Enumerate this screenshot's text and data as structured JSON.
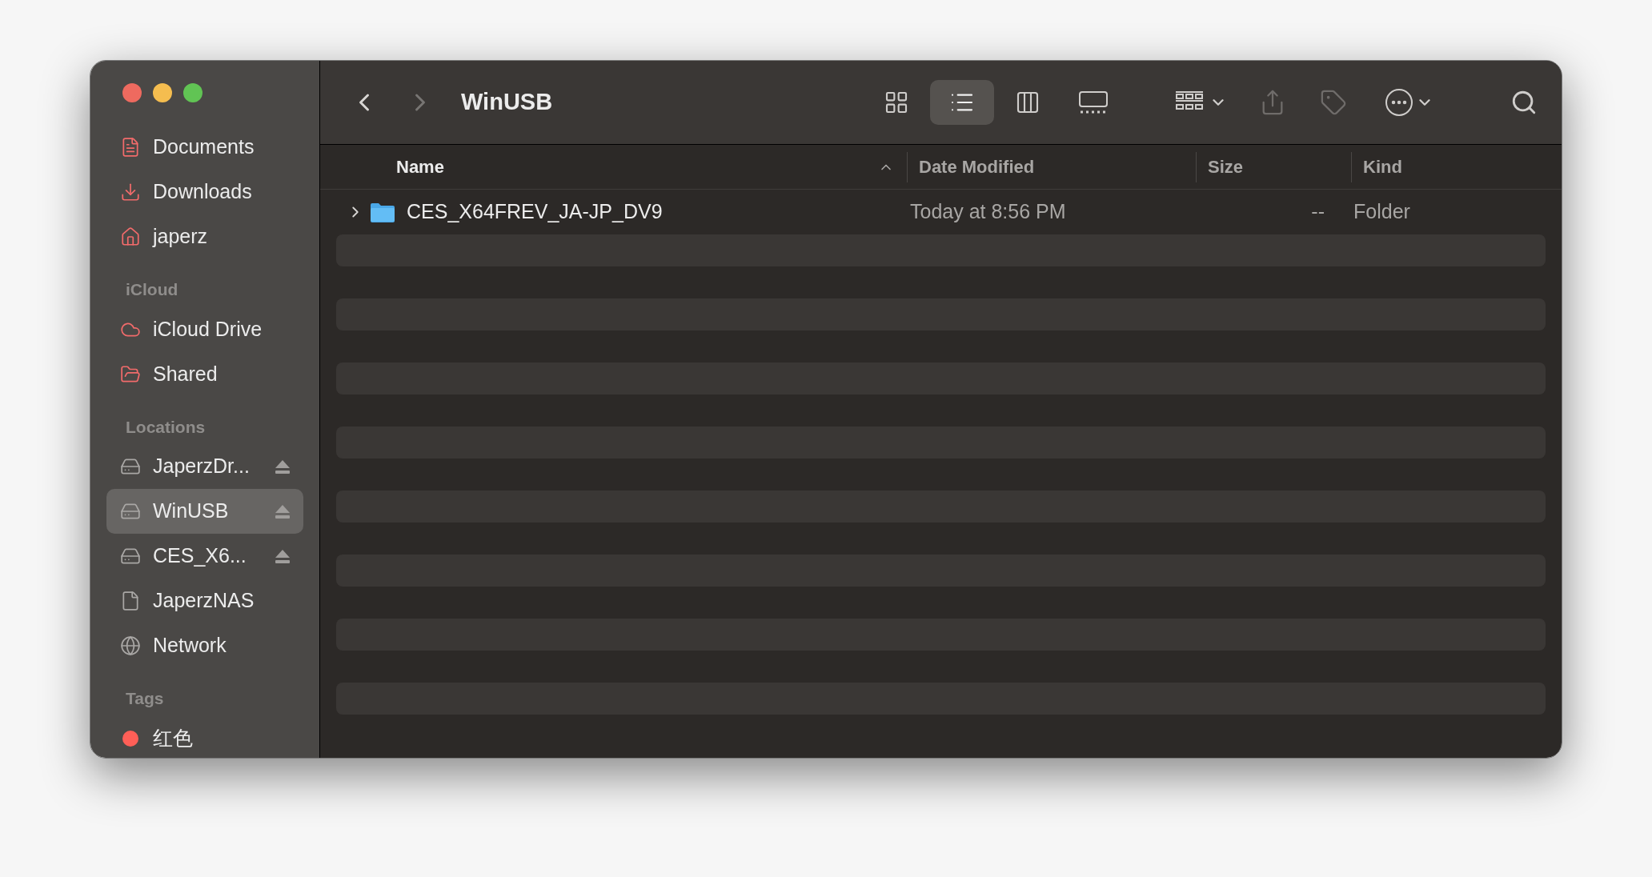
{
  "window": {
    "title": "WinUSB"
  },
  "sidebar": {
    "sections": [
      {
        "items": [
          {
            "label": "Documents",
            "kind": "document",
            "selected": false
          },
          {
            "label": "Downloads",
            "kind": "download",
            "selected": false
          },
          {
            "label": "japerz",
            "kind": "home",
            "selected": false
          }
        ]
      },
      {
        "header": "iCloud",
        "items": [
          {
            "label": "iCloud Drive",
            "kind": "cloud",
            "selected": false
          },
          {
            "label": "Shared",
            "kind": "shared",
            "selected": false
          }
        ]
      },
      {
        "header": "Locations",
        "items": [
          {
            "label": "JaperzDr...",
            "kind": "drive",
            "selected": false,
            "eject": true
          },
          {
            "label": "WinUSB",
            "kind": "drive",
            "selected": true,
            "eject": true
          },
          {
            "label": "CES_X6...",
            "kind": "drive",
            "selected": false,
            "eject": true
          },
          {
            "label": "JaperzNAS",
            "kind": "file",
            "selected": false
          },
          {
            "label": "Network",
            "kind": "network",
            "selected": false
          }
        ]
      },
      {
        "header": "Tags",
        "items": [
          {
            "label": "红色",
            "kind": "tag",
            "selected": false,
            "color": "#ff5f57"
          }
        ]
      }
    ]
  },
  "toolbar": {
    "views": [
      {
        "kind": "icons",
        "selected": false
      },
      {
        "kind": "list",
        "selected": true
      },
      {
        "kind": "columns",
        "selected": false
      },
      {
        "kind": "gallery",
        "selected": false
      }
    ]
  },
  "table": {
    "columns": [
      {
        "label": "Name",
        "sorted": true
      },
      {
        "label": "Date Modified",
        "sorted": false
      },
      {
        "label": "Size",
        "sorted": false
      },
      {
        "label": "Kind",
        "sorted": false
      }
    ],
    "rows": [
      {
        "name": "CES_X64FREV_JA-JP_DV9",
        "date": "Today at 8:56 PM",
        "size": "--",
        "kind": "Folder",
        "expanded": false
      }
    ]
  }
}
